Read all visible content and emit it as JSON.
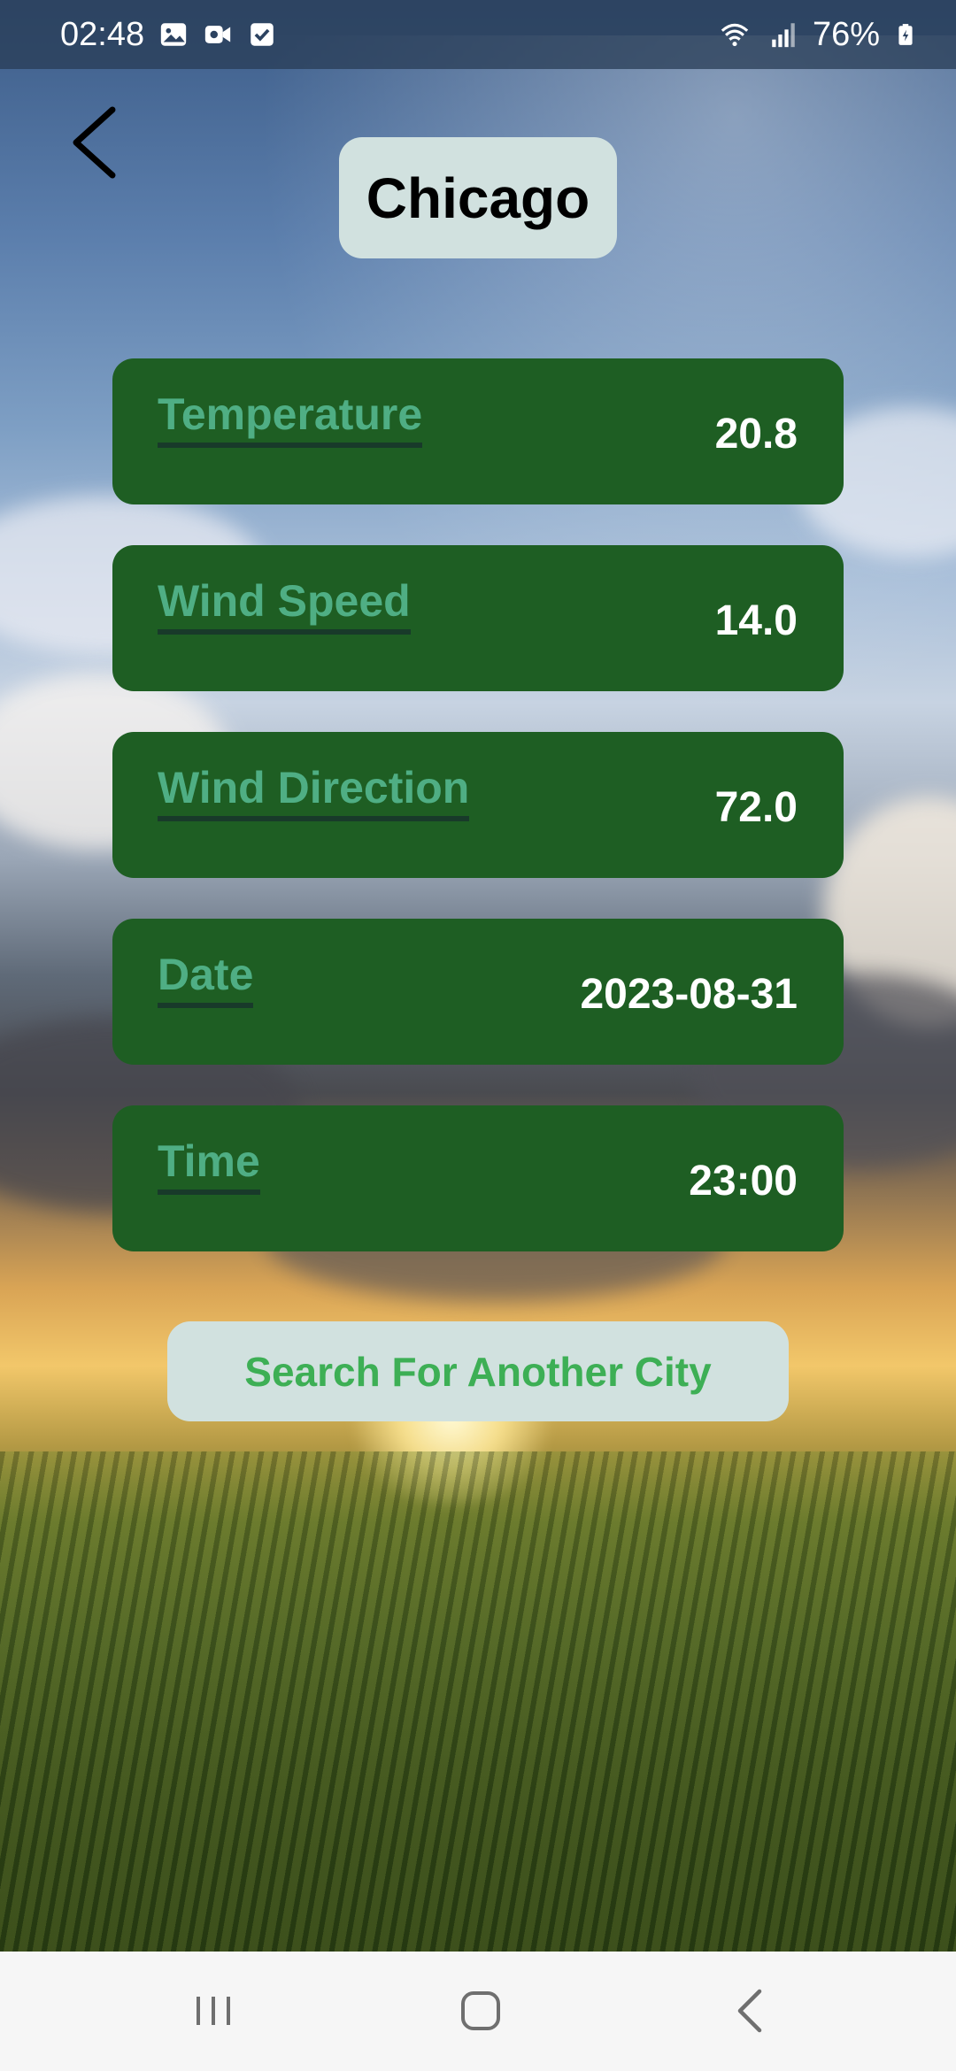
{
  "status_bar": {
    "time": "02:48",
    "battery": "76%",
    "icons": [
      "gallery-icon",
      "video-camera-icon",
      "checkbox-icon",
      "wifi-icon",
      "signal-icon",
      "battery-charging-icon"
    ]
  },
  "header": {
    "back_icon": "back-arrow-icon",
    "city": "Chicago"
  },
  "weather": {
    "items": [
      {
        "label": "Temperature",
        "value": "20.8"
      },
      {
        "label": "Wind Speed",
        "value": "14.0"
      },
      {
        "label": "Wind Direction",
        "value": "72.0"
      },
      {
        "label": "Date",
        "value": "2023-08-31"
      },
      {
        "label": "Time",
        "value": "23:00"
      }
    ]
  },
  "actions": {
    "search_label": "Search For Another City"
  },
  "nav_bar": {
    "icons": [
      "recent-apps-icon",
      "home-icon",
      "back-icon"
    ]
  },
  "colors": {
    "card_background": "#1e5e23",
    "card_label": "#4fae84",
    "chip_background": "#d1e1df",
    "button_text": "#3daf55"
  }
}
